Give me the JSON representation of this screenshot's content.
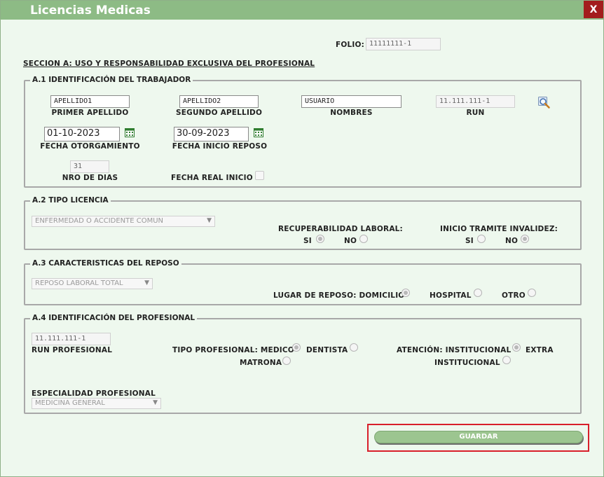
{
  "window": {
    "title": "Licencias Medicas",
    "close_label": "X"
  },
  "folio": {
    "label": "FOLIO:",
    "value": "11111111-1"
  },
  "section_a_title": "SECCION A: USO Y RESPONSABILIDAD EXCLUSIVA DEL PROFESIONAL",
  "a1": {
    "legend": "A.1 IDENTIFICACIÓN DEL TRABAJADOR",
    "primer_apellido": {
      "label": "PRIMER APELLIDO",
      "value": "APELLIDO1"
    },
    "segundo_apellido": {
      "label": "SEGUNDO APELLIDO",
      "value": "APELLIDO2"
    },
    "nombres": {
      "label": "NOMBRES",
      "value": "USUARIO"
    },
    "run": {
      "label": "RUN",
      "value": "11.111.111-1"
    },
    "fecha_otorgamiento": {
      "label": "FECHA OTORGAMIENTO",
      "value": "01-10-2023"
    },
    "fecha_inicio_reposo": {
      "label": "FECHA INICIO REPOSO",
      "value": "30-09-2023"
    },
    "nro_dias": {
      "label": "NRO DE DIAS",
      "value": "31"
    },
    "fecha_real_inicio": {
      "label": "FECHA REAL INICIO",
      "checked": false
    }
  },
  "a2": {
    "legend": "A.2 TIPO LICENCIA",
    "tipo_licencia": "ENFERMEDAD O ACCIDENTE COMUN",
    "recuperabilidad": {
      "label": "RECUPERABILIDAD LABORAL:",
      "si": "SI",
      "no": "NO",
      "selected": "si"
    },
    "invalidez": {
      "label": "INICIO TRAMITE INVALIDEZ:",
      "si": "SI",
      "no": "NO",
      "selected": "no"
    }
  },
  "a3": {
    "legend": "A.3 CARACTERISTICAS DEL REPOSO",
    "tipo_reposo": "REPOSO LABORAL TOTAL",
    "lugar": {
      "label": "LUGAR DE REPOSO: DOMICILIO",
      "hospital": "HOSPITAL",
      "otro": "OTRO",
      "selected": "domicilio"
    }
  },
  "a4": {
    "legend": "A.4 IDENTIFICACIÓN DEL PROFESIONAL",
    "run_profesional": {
      "label": "RUN PROFESIONAL",
      "value": "11.111.111-1"
    },
    "tipo_profesional": {
      "label": "TIPO PROFESIONAL: MEDICO",
      "dentista": "DENTISTA",
      "matrona": "MATRONA",
      "selected": "medico"
    },
    "atencion": {
      "label": "ATENCIÓN: INSTITUCIONAL",
      "extra": "EXTRA",
      "extra2": "INSTITUCIONAL",
      "selected": "institucional"
    },
    "especialidad": {
      "label": "ESPECIALIDAD PROFESIONAL",
      "value": "MEDICINA GENERAL"
    }
  },
  "actions": {
    "save_label": "GUARDAR"
  },
  "colors": {
    "titlebar": "#8dbb85",
    "background": "#eef8ee",
    "close": "#a31d1d",
    "highlight": "#d81f2a",
    "button": "#9cc590"
  },
  "icons": {
    "calendar": "calendar-icon",
    "search": "search-icon",
    "caret": "chevron-down-icon"
  }
}
